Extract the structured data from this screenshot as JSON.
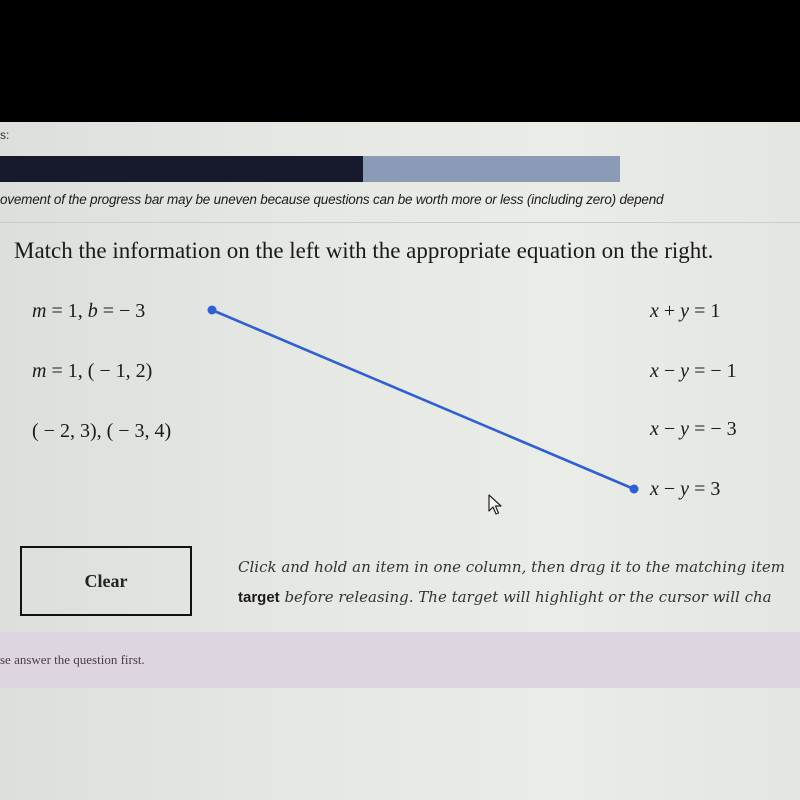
{
  "header": {
    "label": "s:"
  },
  "progress": {
    "fraction": 0.585,
    "note": "ovement of the progress bar may be uneven because questions can be worth more or less (including zero) depend"
  },
  "question": {
    "title": "Match the information on the left with the appropriate equation on the right.",
    "left_items": [
      {
        "id": "L1",
        "parts": [
          "m",
          " = 1, ",
          "b",
          " =  − 3"
        ]
      },
      {
        "id": "L2",
        "parts": [
          "m",
          " = 1, ( − 1, 2)"
        ]
      },
      {
        "id": "L3",
        "text": "( − 2, 3), ( − 3, 4)"
      }
    ],
    "right_items": [
      {
        "id": "R1",
        "parts": [
          "x",
          " + ",
          "y",
          " = 1"
        ]
      },
      {
        "id": "R2",
        "parts": [
          "x",
          " − ",
          "y",
          " =  − 1"
        ]
      },
      {
        "id": "R3",
        "parts": [
          "x",
          " − ",
          "y",
          " =  − 3"
        ]
      },
      {
        "id": "R4",
        "parts": [
          "x",
          " − ",
          "y",
          " = 3"
        ]
      }
    ],
    "connections": [
      {
        "from": "L1",
        "to": "R4"
      }
    ],
    "line_color": "#2f5fd6"
  },
  "controls": {
    "clear_label": "Clear"
  },
  "instructions": {
    "line1": "Click and hold an item in one column, then drag it to the matching item",
    "line2_bold": "target",
    "line2_rest": " before releasing. The target will highlight or the cursor will cha"
  },
  "status": {
    "message": "se answer the question first."
  }
}
